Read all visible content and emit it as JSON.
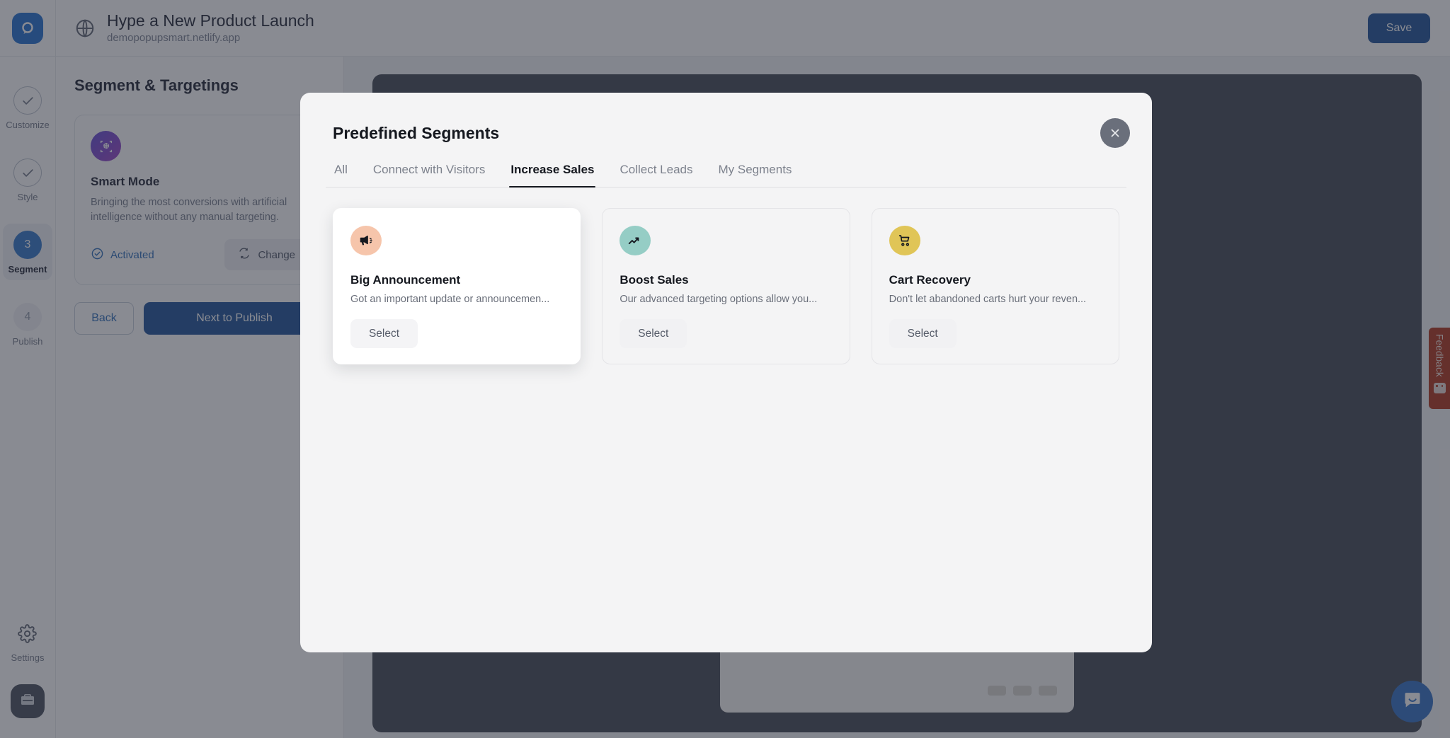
{
  "topbar": {
    "logo_icon": "popupsmart-logo-icon",
    "globe_icon": "globe-icon",
    "title": "Hype a New Product Launch",
    "domain": "demopopupsmart.netlify.app",
    "save_label": "Save"
  },
  "rail": {
    "steps": [
      {
        "label": "Customize",
        "marker": "check",
        "state": "done"
      },
      {
        "label": "Style",
        "marker": "check",
        "state": "done"
      },
      {
        "label": "Segment",
        "marker": "3",
        "state": "current"
      },
      {
        "label": "Publish",
        "marker": "4",
        "state": "pending"
      }
    ],
    "settings_label": "Settings",
    "settings_icon": "gear-icon",
    "toolbox_icon": "toolbox-icon"
  },
  "panel": {
    "heading": "Segment & Targetings",
    "mode_card": {
      "icon": "smart-target-icon",
      "title": "Smart Mode",
      "description": "Bringing the most conversions with artificial intelligence without any manual targeting.",
      "status_label": "Activated",
      "status_icon": "check-circle-icon",
      "change_label": "Change",
      "change_icon": "refresh-icon"
    },
    "back_label": "Back",
    "next_label": "Next to Publish"
  },
  "modal": {
    "title": "Predefined Segments",
    "close_icon": "close-icon",
    "tabs": [
      {
        "label": "All",
        "active": false
      },
      {
        "label": "Connect with Visitors",
        "active": false
      },
      {
        "label": "Increase Sales",
        "active": true
      },
      {
        "label": "Collect Leads",
        "active": false
      },
      {
        "label": "My Segments",
        "active": false
      }
    ],
    "cards": [
      {
        "name": "Big Announcement",
        "description": "Got an important update or announcemen...",
        "select_label": "Select",
        "icon": "megaphone-icon",
        "icon_bg": "#f6c5ab",
        "hovered": true
      },
      {
        "name": "Boost Sales",
        "description": "Our advanced targeting options allow you...",
        "select_label": "Select",
        "icon": "trending-up-icon",
        "icon_bg": "#95cdc5",
        "hovered": false
      },
      {
        "name": "Cart Recovery",
        "description": "Don't let abandoned carts hurt your reven...",
        "select_label": "Select",
        "icon": "shopping-cart-icon",
        "icon_bg": "#e0c557",
        "hovered": false
      }
    ]
  },
  "widgets": {
    "feedback_label": "Feedback",
    "feedback_icon": "smiley-face-icon",
    "feedback_color": "#ad3118",
    "chat_icon": "chat-bubble-icon",
    "chat_color": "#2f6fc4"
  },
  "colors": {
    "primary": "#1b4f96",
    "accent": "#2f74c9",
    "link": "#2b6cb8"
  }
}
